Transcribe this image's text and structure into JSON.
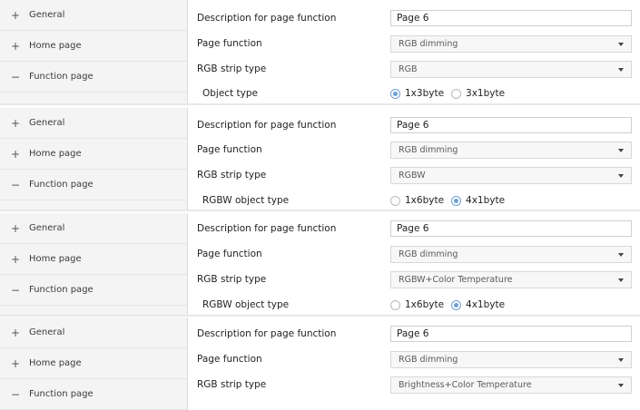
{
  "sidebar_items": [
    "General",
    "Home page",
    "Function page"
  ],
  "sidebar_signs": [
    "+",
    "+",
    "−"
  ],
  "labels": {
    "description": "Description for page function",
    "page_function": "Page function",
    "strip_type": "RGB strip type",
    "object_type": "Object type",
    "rgbw_object_type": "RGBW object type"
  },
  "panels": [
    {
      "description_value": "Page 6",
      "page_function_value": "RGB dimming",
      "strip_type_value": "RGB",
      "radio_label": "Object type",
      "radio_options": [
        "1x3byte",
        "3x1byte"
      ],
      "radio_selected": "1x3byte"
    },
    {
      "description_value": "Page 6",
      "page_function_value": "RGB dimming",
      "strip_type_value": "RGBW",
      "radio_label": "RGBW object type",
      "radio_options": [
        "1x6byte",
        "4x1byte"
      ],
      "radio_selected": "4x1byte"
    },
    {
      "description_value": "Page 6",
      "page_function_value": "RGB dimming",
      "strip_type_value": "RGBW+Color Temperature",
      "radio_label": "RGBW object type",
      "radio_options": [
        "1x6byte",
        "4x1byte"
      ],
      "radio_selected": "4x1byte"
    },
    {
      "description_value": "Page 6",
      "page_function_value": "RGB dimming",
      "strip_type_value": "Brightness+Color Temperature"
    }
  ],
  "colors": {
    "sidebar_bg": "#f4f4f4",
    "radio_accent": "#6f9fd4",
    "select_bg": "#f7f7f7"
  }
}
